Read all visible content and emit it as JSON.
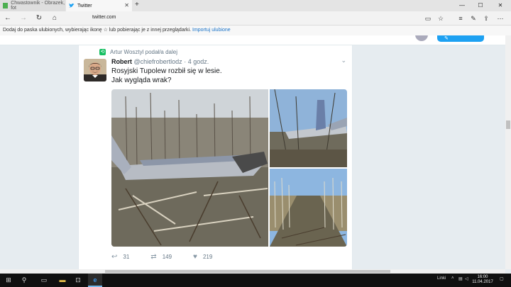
{
  "browser": {
    "tabs": [
      {
        "title": "Chwastownik - Obrazek, fot"
      },
      {
        "title": "Twitter"
      }
    ],
    "address": "twitter.com",
    "favorites_prompt": "Dodaj do paska ulubionych, wybierając ikonę ☆ lub pobierając je z innej przeglądarki.",
    "favorites_link": "Importuj ulubione"
  },
  "tweet": {
    "retweeted_by": "Artur Wosztyl podał/a dalej",
    "author_name": "Robert",
    "author_handle": "@chiefrobertlodz",
    "time": "· 4 godz.",
    "text_line1": "Rosyjski Tupolew rozbił się w lesie.",
    "text_line2": "Jak wygląda wrak?",
    "replies": "31",
    "retweets": "149",
    "likes": "219"
  },
  "taskbar": {
    "links_label": "Linki",
    "time": "16:00",
    "date": "11.04.2017"
  },
  "colors": {
    "twitter_blue": "#1da1f2",
    "retweet_green": "#17bf63",
    "link_blue": "#1a73c8"
  }
}
